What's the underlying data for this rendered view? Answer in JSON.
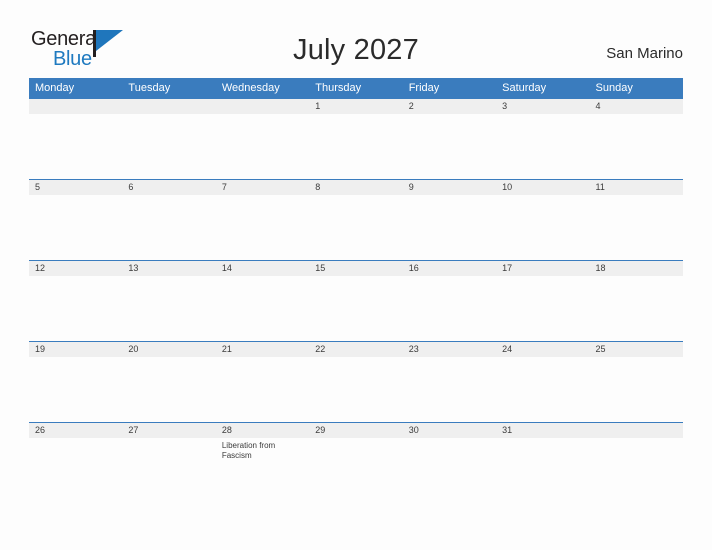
{
  "logo": {
    "word_top": "General",
    "word_bottom": "Blue",
    "flag_icon": "blue-flag-triangle-icon",
    "top_color": "#231f20",
    "bottom_color": "#1f7ac0"
  },
  "header": {
    "title": "July 2027",
    "region": "San Marino"
  },
  "colors": {
    "header_blue": "#3a7cbe",
    "band_gray": "#efefef",
    "text_dark": "#2b2b2b",
    "page_background": "#fdfdfd"
  },
  "calendar": {
    "weekdays": [
      "Monday",
      "Tuesday",
      "Wednesday",
      "Thursday",
      "Friday",
      "Saturday",
      "Sunday"
    ],
    "weeks": [
      [
        {
          "day": "",
          "event": ""
        },
        {
          "day": "",
          "event": ""
        },
        {
          "day": "",
          "event": ""
        },
        {
          "day": "1",
          "event": ""
        },
        {
          "day": "2",
          "event": ""
        },
        {
          "day": "3",
          "event": ""
        },
        {
          "day": "4",
          "event": ""
        }
      ],
      [
        {
          "day": "5",
          "event": ""
        },
        {
          "day": "6",
          "event": ""
        },
        {
          "day": "7",
          "event": ""
        },
        {
          "day": "8",
          "event": ""
        },
        {
          "day": "9",
          "event": ""
        },
        {
          "day": "10",
          "event": ""
        },
        {
          "day": "11",
          "event": ""
        }
      ],
      [
        {
          "day": "12",
          "event": ""
        },
        {
          "day": "13",
          "event": ""
        },
        {
          "day": "14",
          "event": ""
        },
        {
          "day": "15",
          "event": ""
        },
        {
          "day": "16",
          "event": ""
        },
        {
          "day": "17",
          "event": ""
        },
        {
          "day": "18",
          "event": ""
        }
      ],
      [
        {
          "day": "19",
          "event": ""
        },
        {
          "day": "20",
          "event": ""
        },
        {
          "day": "21",
          "event": ""
        },
        {
          "day": "22",
          "event": ""
        },
        {
          "day": "23",
          "event": ""
        },
        {
          "day": "24",
          "event": ""
        },
        {
          "day": "25",
          "event": ""
        }
      ],
      [
        {
          "day": "26",
          "event": ""
        },
        {
          "day": "27",
          "event": ""
        },
        {
          "day": "28",
          "event": "Liberation from Fascism"
        },
        {
          "day": "29",
          "event": ""
        },
        {
          "day": "30",
          "event": ""
        },
        {
          "day": "31",
          "event": ""
        },
        {
          "day": "",
          "event": ""
        }
      ]
    ]
  }
}
